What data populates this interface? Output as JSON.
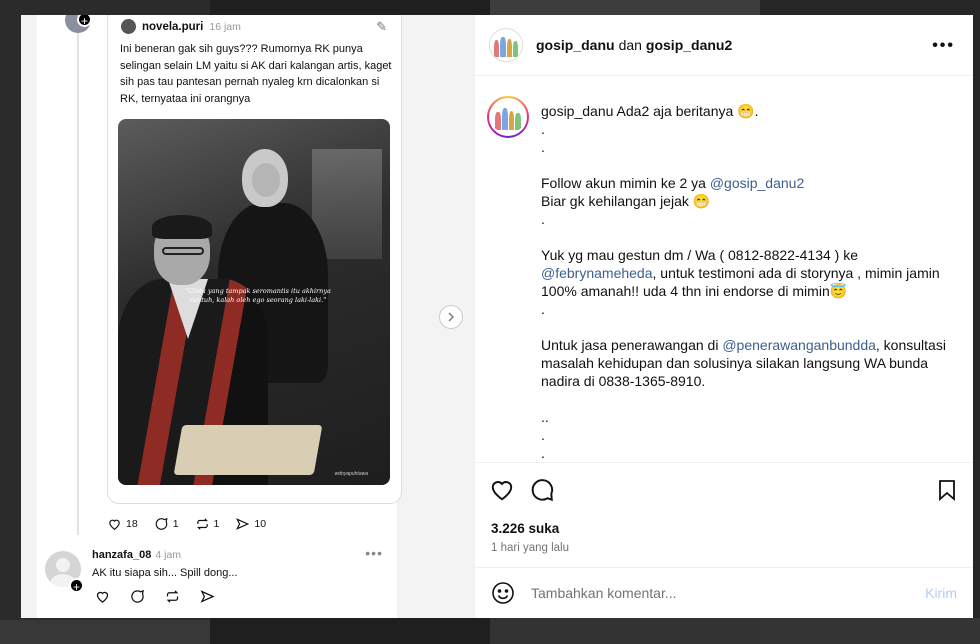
{
  "colors": {
    "accent": "#0095f6",
    "link": "#3d5f8f",
    "send_disabled": "#b3cdf5",
    "muted": "#737373"
  },
  "thread_screenshot": {
    "quote_user": "novela.puri",
    "quote_time": "16 jam",
    "quote_text": "Ini beneran gak sih guys??? Rumornya RK punya selingan selain LM yaitu si AK dari kalangan artis, kaget sih pas tau pantesan pernah nyaleg krn dicalonkan si RK, ternyataa ini orangnya",
    "photo_quote": "\"Cinta yang tampak seromantis itu akhirnya runtuh, kalah oleh ego seorang laki-laki.\"",
    "photo_watermark": "wdnyapuhtawa",
    "stats": {
      "likes": "18",
      "replies": "1",
      "reposts": "1",
      "shares": "10"
    },
    "reply_user": "hanzafa_08",
    "reply_time": "4 jam",
    "reply_text": "AK itu siapa sih... Spill dong..."
  },
  "post": {
    "author": "gosip_danu",
    "and_word": "dan",
    "collab": "gosip_danu2",
    "more_icon": "more-horizontal-icon",
    "caption": {
      "username": "gosip_danu",
      "line1": "Ada2 aja beritanya 😁.",
      "dot1": ".",
      "dot2": ".",
      "follow_pre": "Follow akun mimin ke 2 ya ",
      "follow_link": "@gosip_danu2",
      "follow_post": "Biar gk kehilangan jejak 😁",
      "dot3": ".",
      "gestun_pre": "Yuk yg mau gestun dm / Wa ( 0812-8822-4134 ) ke ",
      "gestun_link": "@febrynameheda",
      "gestun_post": ", untuk testimoni ada di storynya , mimin jamin 100% amanah!! uda 4 thn ini endorse di mimin😇",
      "dot4": ".",
      "jasa_pre": "Untuk jasa penerawangan di ",
      "jasa_link": "@penerawanganbundda",
      "jasa_post": ", konsultasi masalah kehidupan dan solusinya silakan langsung WA bunda nadira di 0838-1365-8910.",
      "dot5": "..",
      "dot6": ".",
      "dot7": "."
    },
    "likes": "3.226 suka",
    "time": "1 hari yang lalu",
    "comment_placeholder": "Tambahkan komentar...",
    "send_label": "Kirim"
  }
}
